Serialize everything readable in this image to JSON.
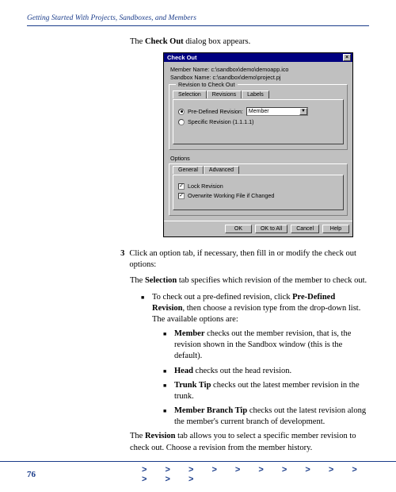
{
  "header": {
    "title": "Getting Started With Projects, Sandboxes, and Members"
  },
  "intro": {
    "text_pre": "The ",
    "bold": "Check Out",
    "text_post": " dialog box appears."
  },
  "dialog": {
    "title": "Check Out",
    "close": "×",
    "member_label": "Member Name:",
    "member_value": "c:\\sandbox\\demo\\demoapp.ico",
    "sandbox_label": "Sandbox Name:",
    "sandbox_value": "c:\\sandbox\\demo\\project.pj",
    "group1": "Revision to Check Out",
    "tabs1": [
      "Selection",
      "Revisions",
      "Labels"
    ],
    "radio_predef": "Pre-Defined Revision:",
    "dropdown_value": "Member",
    "radio_specific": "Specific Revision (1.1.1.1)",
    "options_label": "Options",
    "tabs2": [
      "General",
      "Advanced"
    ],
    "chk_lock": "Lock Revision",
    "chk_overwrite": "Overwrite Working File if Changed",
    "buttons": [
      "OK",
      "OK to All",
      "Cancel",
      "Help"
    ]
  },
  "step3": {
    "num": "3",
    "text": "Click an option tab, if necessary, then fill in or modify the check out options:",
    "selection_para_pre": "The ",
    "selection_bold": "Selection",
    "selection_para_post": " tab specifies which revision of the member to check out.",
    "b1_pre": "To check out a pre-defined revision, click ",
    "b1_bold": "Pre-Defined Revision",
    "b1_post": ", then choose a revision type from the drop-down list. The available options are:",
    "s1_bold": "Member",
    "s1_text": " checks out the member revision, that is, the revision shown in the Sandbox window (this is the default).",
    "s2_bold": "Head",
    "s2_text": " checks out the head revision.",
    "s3_bold": "Trunk Tip",
    "s3_text": " checks out the latest member revision in the trunk.",
    "s4_bold": "Member Branch Tip",
    "s4_text": " checks out the latest revision along the member's current branch of development.",
    "rev_para_pre": "The ",
    "rev_bold": "Revision",
    "rev_para_post": " tab allows you to select a specific member revision to check out. Choose a revision from the member history."
  },
  "footer": {
    "page": "76",
    "arrows": "> > > > > > > > > > > > >"
  }
}
